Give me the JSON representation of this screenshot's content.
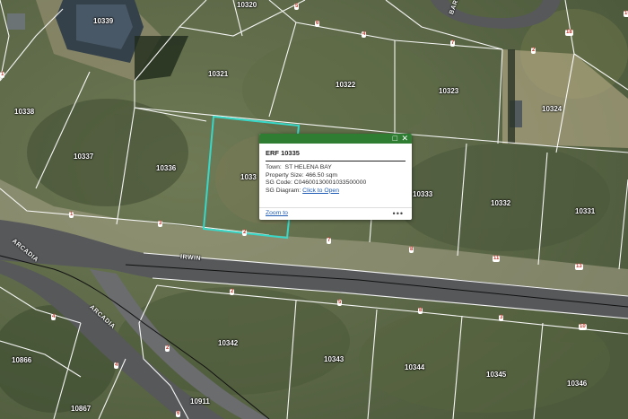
{
  "parcels": [
    "10320",
    "10339",
    "10321",
    "10322",
    "10323",
    "10324",
    "10338",
    "10337",
    "10336",
    "10333",
    "10332",
    "10331",
    "10342",
    "10343",
    "10344",
    "10345",
    "10346",
    "10866",
    "10867",
    "10911"
  ],
  "selected_parcel_partial": "1033",
  "roads": {
    "irwin": "IRWIN",
    "arcadia": "ARCADIA",
    "barr": "BARR"
  },
  "segment_numbers": [
    "5",
    "6",
    "1",
    "12",
    "7",
    "10",
    "2",
    "3",
    "4",
    "1",
    "2",
    "3",
    "4",
    "13",
    "11",
    "8",
    "7",
    "6",
    "2",
    "3",
    "4",
    "5",
    "6",
    "8",
    "10",
    "19",
    "18",
    "4",
    "4",
    "2"
  ],
  "popup": {
    "title": "ERF 10335",
    "town_label": "Town:",
    "town_value": "ST HELENA BAY",
    "size_label": "Property Size:",
    "size_value": "466.50 sqm",
    "sg_code_label": "SG Code:",
    "sg_code_value": "C04600130001033500000",
    "sg_diagram_label": "SG Diagram:",
    "sg_diagram_link": "Click to Open",
    "zoom_to": "Zoom to",
    "more": "•••",
    "maximize_icon": "□",
    "close_icon": "✕"
  },
  "colors": {
    "header": "#2e7d32",
    "highlight": "#38d8c8",
    "link": "#1d5bb5",
    "segment_text": "#c0392b"
  }
}
